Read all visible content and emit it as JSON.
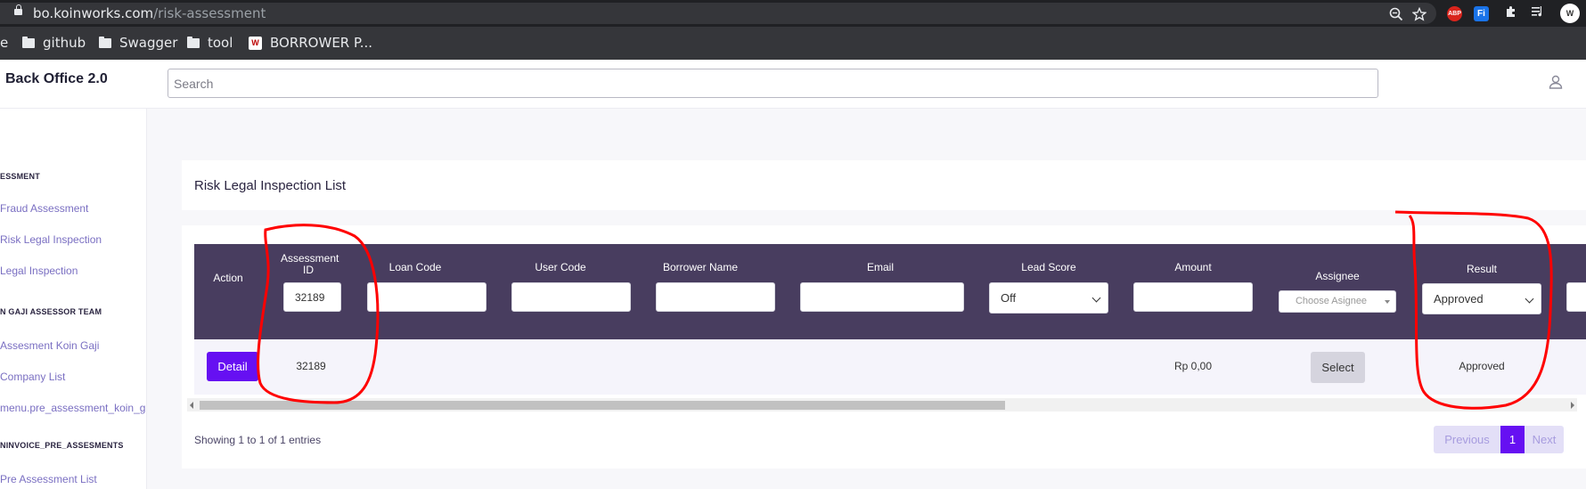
{
  "browser": {
    "url_host": "bo.koinworks.com",
    "url_path": "/risk-assessment",
    "icons": [
      "lock-icon",
      "zoom-icon",
      "star-icon",
      "abp-extension-icon",
      "fi-extension-icon",
      "puzzle-icon",
      "media-icon",
      "profile-icon"
    ],
    "abp_label": "ABP",
    "fi_label": "Fi",
    "profile_initials": "W",
    "bookmarks": [
      {
        "label": "e"
      },
      {
        "label": "github"
      },
      {
        "label": "Swagger"
      },
      {
        "label": "tool"
      },
      {
        "label": "BORROWER P..."
      }
    ],
    "bookmark_logo": "W"
  },
  "header": {
    "brand": "Back Office 2.0",
    "search_placeholder": "Search"
  },
  "sidebar": {
    "sections": [
      {
        "heading": "ESSMENT",
        "items": [
          "Fraud Assessment",
          "Risk Legal Inspection",
          "Legal Inspection"
        ]
      },
      {
        "heading": "N GAJI ASSESSOR TEAM",
        "items": [
          "Assesment Koin Gaji",
          "Company List",
          "menu.pre_assessment_koin_g"
        ]
      },
      {
        "heading": "NINVOICE_PRE_ASSESMENTS",
        "items": [
          "Pre Assessment List"
        ]
      }
    ]
  },
  "page": {
    "title": "Risk Legal Inspection List"
  },
  "table": {
    "columns": {
      "action": "Action",
      "assessment_id": "Assessment ID",
      "loan_code": "Loan Code",
      "user_code": "User Code",
      "borrower_name": "Borrower Name",
      "email": "Email",
      "lead_score": "Lead Score",
      "amount": "Amount",
      "assignee": "Assignee",
      "result": "Result"
    },
    "filters": {
      "assessment_id": "32189",
      "loan_code": "",
      "user_code": "",
      "borrower_name": "",
      "email": "",
      "lead_score": "Off",
      "amount": "",
      "assignee_placeholder": "Choose Asignee",
      "result": "Approved"
    },
    "rows": [
      {
        "detail_label": "Detail",
        "assessment_id": "32189",
        "loan_code": "",
        "user_code": "",
        "borrower_name": "",
        "email": "",
        "lead_score": "",
        "amount": "Rp 0,00",
        "assignee_label": "Select",
        "result": "Approved"
      }
    ],
    "showing": "Showing 1 to 1 of 1 entries",
    "pagination": {
      "previous": "Previous",
      "current": "1",
      "next": "Next"
    }
  },
  "colors": {
    "accent": "#6610f2",
    "table_header": "#483d5f",
    "annotation": "#ff0000"
  }
}
